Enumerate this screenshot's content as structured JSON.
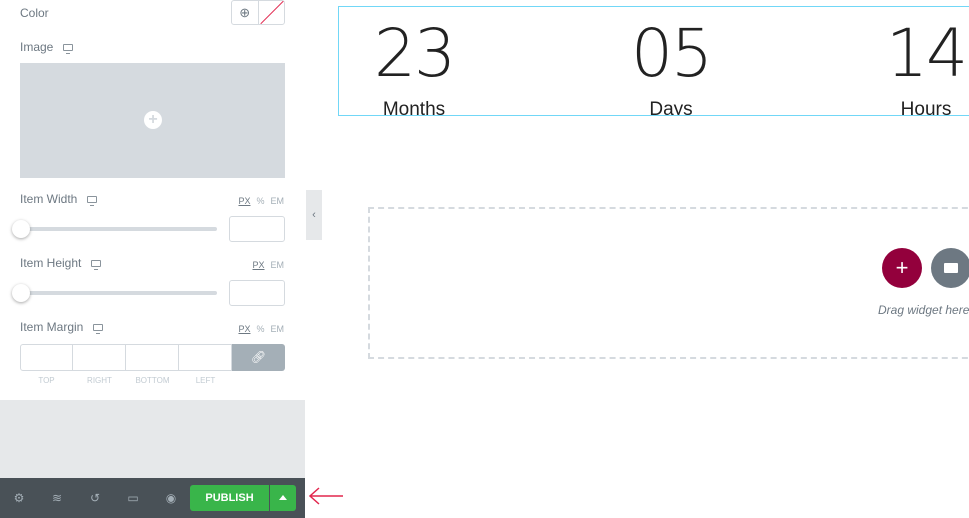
{
  "panel": {
    "color_label": "Color",
    "image_label": "Image",
    "item_width": {
      "label": "Item Width",
      "units": [
        "PX",
        "%",
        "EM"
      ],
      "active_unit": "PX",
      "value": ""
    },
    "item_height": {
      "label": "Item Height",
      "units": [
        "PX",
        "EM"
      ],
      "active_unit": "PX",
      "value": ""
    },
    "item_margin": {
      "label": "Item Margin",
      "units": [
        "PX",
        "%",
        "EM"
      ],
      "active_unit": "PX",
      "fields": [
        "TOP",
        "RIGHT",
        "BOTTOM",
        "LEFT"
      ]
    }
  },
  "footer": {
    "publish_label": "PUBLISH",
    "icons": [
      "gear-icon",
      "layers-icon",
      "history-icon",
      "responsive-icon",
      "eye-icon"
    ]
  },
  "countdown": [
    {
      "value": "23",
      "label": "Months"
    },
    {
      "value": "05",
      "label": "Days"
    },
    {
      "value": "14",
      "label": "Hours"
    }
  ],
  "dropzone": {
    "text": "Drag widget here",
    "add_color": "#93003c",
    "folder_color": "#6d7882"
  },
  "colors": {
    "accent_border": "#71d7f7",
    "publish": "#39b54a",
    "arrow": "#e2264d"
  }
}
